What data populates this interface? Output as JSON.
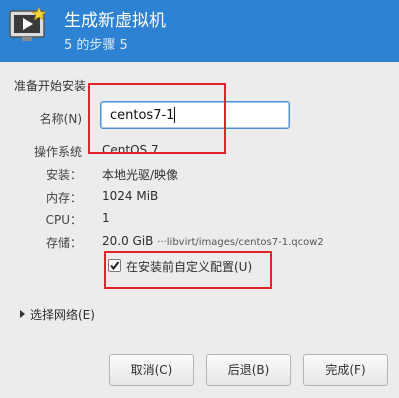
{
  "header": {
    "title": "生成新虚拟机",
    "subtitle": "5 的步骤 5",
    "icon": "monitor-star-icon",
    "bg_color": "#2d82d3"
  },
  "form": {
    "section_heading": "准备开始安装",
    "name_label": "名称(N)",
    "name_value": "centos7-1",
    "os_label": "操作系统",
    "os_value": "CentOS 7",
    "install_label": "安装：",
    "install_value": "本地光驱/映像",
    "memory_label": "内存：",
    "memory_value": "1024 MiB",
    "cpu_label": "CPU：",
    "cpu_value": "1",
    "storage_label": "存储：",
    "storage_size": "20.0 GiB",
    "storage_path": "···libvirt/images/centos7-1.qcow2",
    "customize_label": "在安装前自定义配置(U)",
    "customize_checked": true
  },
  "network": {
    "expander_label": "选择网络(E)"
  },
  "buttons": {
    "cancel": "取消(C)",
    "back": "后退(B)",
    "finish": "完成(F)"
  },
  "highlight_color": "#e3232c"
}
